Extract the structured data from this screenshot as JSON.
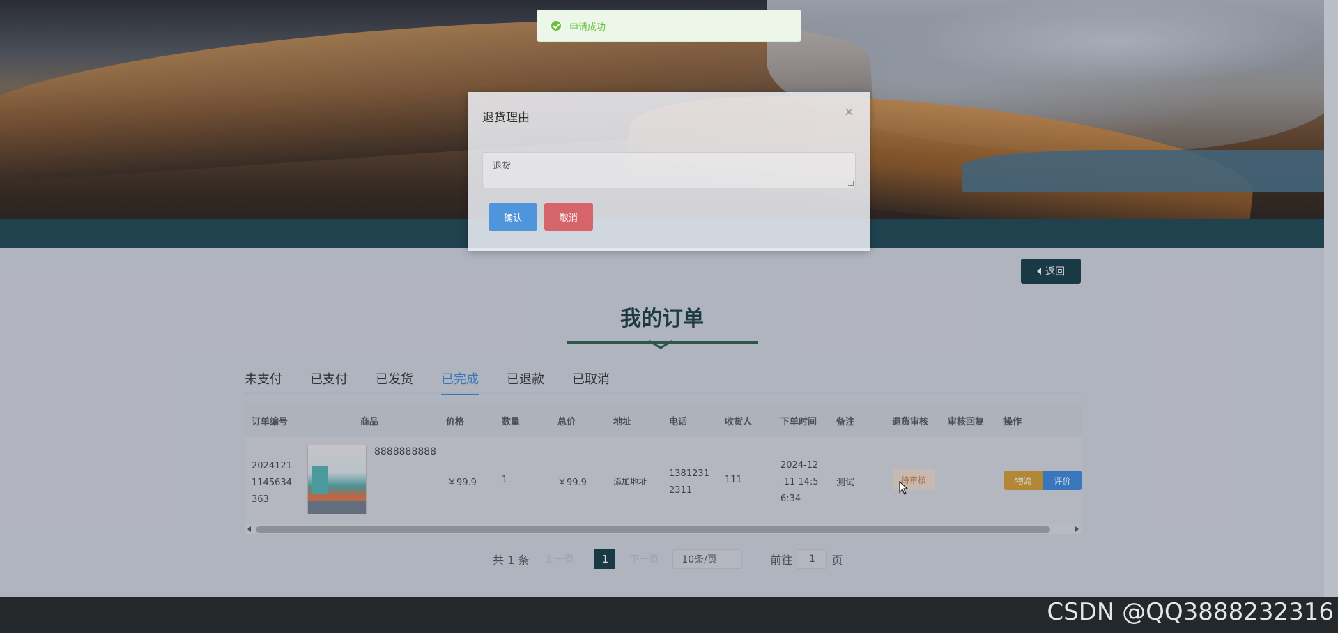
{
  "toast": {
    "message": "申请成功"
  },
  "dialog": {
    "title": "退货理由",
    "close": "×",
    "reason_value": "退货",
    "confirm": "确认",
    "cancel": "取消"
  },
  "back_button": {
    "label": "返回"
  },
  "page_title": "我的订单",
  "tabs": [
    {
      "label": "未支付"
    },
    {
      "label": "已支付"
    },
    {
      "label": "已发货"
    },
    {
      "label": "已完成",
      "active": true
    },
    {
      "label": "已退款"
    },
    {
      "label": "已取消"
    }
  ],
  "table": {
    "headers": [
      "订单编号",
      "商品",
      "价格",
      "数量",
      "总价",
      "地址",
      "电话",
      "收货人",
      "下单时间",
      "备注",
      "退货审核",
      "审核回复",
      "操作"
    ],
    "rows": [
      {
        "order_no_lines": [
          "2024121",
          "1145634",
          "363"
        ],
        "product_name": "8888888888",
        "price": "￥99.9",
        "quantity": "1",
        "total": "￥99.9",
        "address": "添加地址",
        "phone_lines": [
          "1381231",
          "2311"
        ],
        "receiver": "111",
        "order_time_lines": [
          "2024-12",
          "-11 14:5",
          "6:34"
        ],
        "remark": "测试",
        "return_status": "待审核",
        "review_reply": "",
        "actions": {
          "logistics": "物流",
          "review": "评价"
        }
      }
    ]
  },
  "pagination": {
    "total": "共 1 条",
    "prev": "上一页",
    "current": "1",
    "next": "下一页",
    "page_size": "10条/页",
    "goto_label": "前往",
    "goto_value": "1",
    "goto_suffix": "页"
  },
  "watermark": "CSDN @QQ3888232316",
  "colors": {
    "primary_dark": "#173c44",
    "accent_blue": "#3e87d6",
    "logistics_orange": "#d19a32",
    "cancel_red": "#d6656b",
    "success_green": "#67c23a"
  }
}
